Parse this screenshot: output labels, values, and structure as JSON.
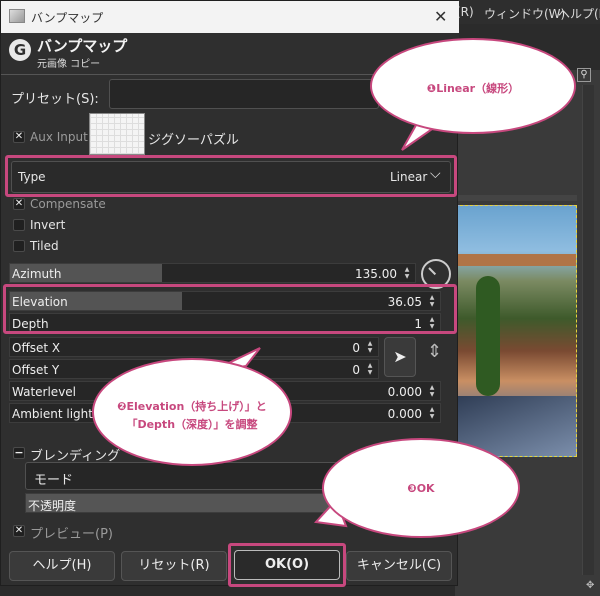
{
  "background": {
    "menu_items": [
      "(R)",
      "ウィンドウ(W)",
      "ヘルプ(H"
    ],
    "thumb_icon": "magnifier-icon"
  },
  "dialog": {
    "window_title": "バンプマップ",
    "header_title": "バンプマップ",
    "header_subtitle": "元画像 コピー",
    "preset_label": "プリセット(S):",
    "aux_input_label": "Aux Input",
    "aux_input_value": "ジグソーパズル",
    "type_label": "Type",
    "type_value": "Linear",
    "compensate_label": "Compensate",
    "invert_label": "Invert",
    "tiled_label": "Tiled",
    "sliders": {
      "azimuth": {
        "label": "Azimuth",
        "value": "135.00",
        "fraction": 0.375
      },
      "elevation": {
        "label": "Elevation",
        "value": "36.05",
        "fraction": 0.4
      },
      "depth": {
        "label": "Depth",
        "value": "1"
      },
      "offset_x": {
        "label": "Offset X",
        "value": "0"
      },
      "offset_y": {
        "label": "Offset Y",
        "value": "0"
      },
      "waterlevel": {
        "label": "Waterlevel",
        "value": "0.000"
      },
      "ambient": {
        "label": "Ambient lighting",
        "value": "0.000"
      }
    },
    "blending_label": "ブレンディング",
    "mode_label": "モード",
    "opacity_label": "不透明度",
    "preview_label": "プレビュー(P)",
    "buttons": {
      "help": "ヘルプ(H)",
      "reset": "リセット(R)",
      "ok": "OK(O)",
      "cancel": "キャンセル(C)"
    }
  },
  "annotations": {
    "callout1": "❶Linear（線形）",
    "callout2_line1": "❷Elevation（持ち上げ）」と",
    "callout2_line2": "「Depth（深度）」を調整",
    "callout3": "❸OK",
    "accent_color": "#c7487e"
  }
}
